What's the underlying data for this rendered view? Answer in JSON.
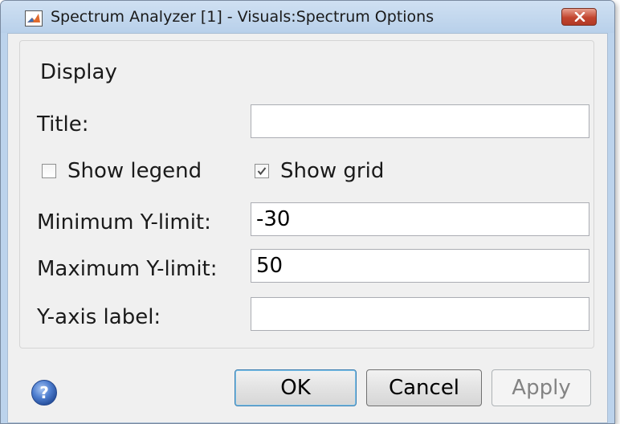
{
  "window": {
    "title": "Spectrum Analyzer [1] - Visuals:Spectrum Options"
  },
  "display_group": {
    "label": "Display",
    "title": {
      "label": "Title:",
      "value": ""
    },
    "show_legend": {
      "label": "Show legend",
      "checked": false
    },
    "show_grid": {
      "label": "Show grid",
      "checked": true
    },
    "min_ylimit": {
      "label": "Minimum Y-limit:",
      "value": "-30"
    },
    "max_ylimit": {
      "label": "Maximum Y-limit:",
      "value": "50"
    },
    "yaxis_label": {
      "label": "Y-axis label:",
      "value": ""
    }
  },
  "buttons": {
    "ok": "OK",
    "cancel": "Cancel",
    "apply": "Apply"
  },
  "icons": {
    "app": "matlab-icon",
    "close": "close-icon",
    "help": "help-icon"
  },
  "colors": {
    "titlebar": "#bcd3ec",
    "close_button": "#c2452f",
    "dialog_background": "#f0f0f0"
  }
}
